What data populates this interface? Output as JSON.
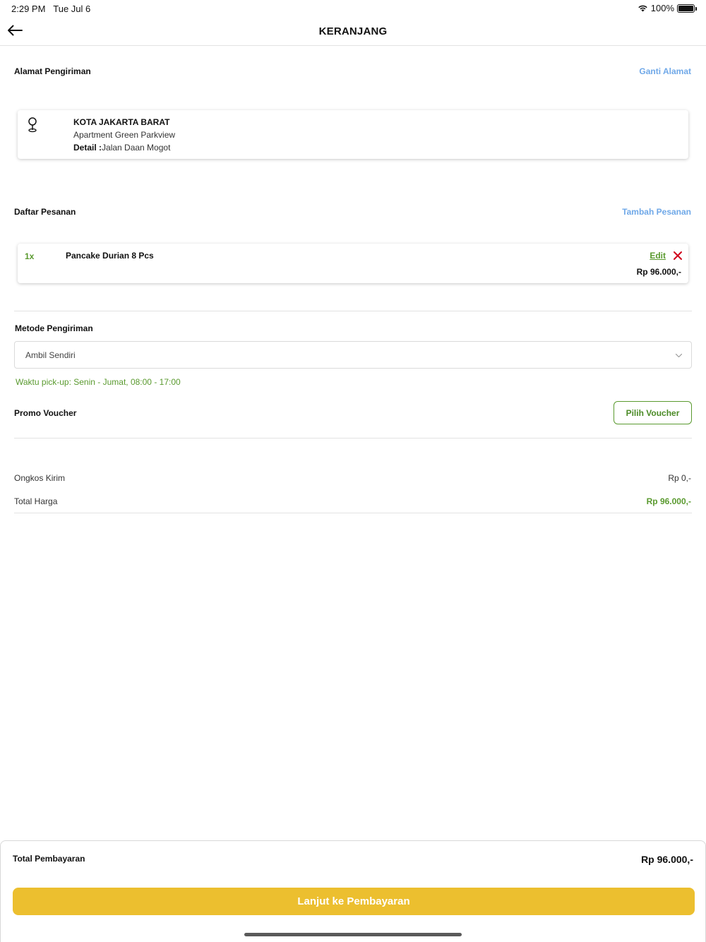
{
  "status_bar": {
    "time": "2:29 PM",
    "date": "Tue Jul 6",
    "battery": "100%"
  },
  "header": {
    "title": "KERANJANG",
    "back_icon": "arrow-left-icon"
  },
  "address": {
    "section_title": "Alamat Pengiriman",
    "change_link": "Ganti Alamat",
    "city": "KOTA JAKARTA BARAT",
    "line": "Apartment Green Parkview",
    "detail_label": "Detail :",
    "detail_value": "Jalan Daan Mogot",
    "icon": "location-pin-icon"
  },
  "orders": {
    "section_title": "Daftar Pesanan",
    "add_link": "Tambah Pesanan",
    "items": [
      {
        "qty": "1x",
        "name": "Pancake Durian 8 Pcs",
        "edit_label": "Edit",
        "price": "Rp 96.000,-"
      }
    ]
  },
  "shipping": {
    "section_title": "Metode Pengiriman",
    "selected": "Ambil Sendiri",
    "pickup_note": "Waktu pick-up: Senin - Jumat, 08:00 - 17:00"
  },
  "voucher": {
    "section_title": "Promo Voucher",
    "button_label": "Pilih Voucher"
  },
  "summary": {
    "shipping_cost_label": "Ongkos Kirim",
    "shipping_cost_value": "Rp 0,-",
    "total_label": "Total Harga",
    "total_value": "Rp 96.000,-"
  },
  "footer": {
    "payment_label": "Total Pembayaran",
    "payment_value": "Rp 96.000,-",
    "continue_label": "Lanjut ke Pembayaran"
  },
  "colors": {
    "accent_green": "#5a9a2f",
    "link_blue": "#6fa8e8",
    "primary_yellow": "#ecbf2f",
    "remove_red": "#d0021b"
  }
}
